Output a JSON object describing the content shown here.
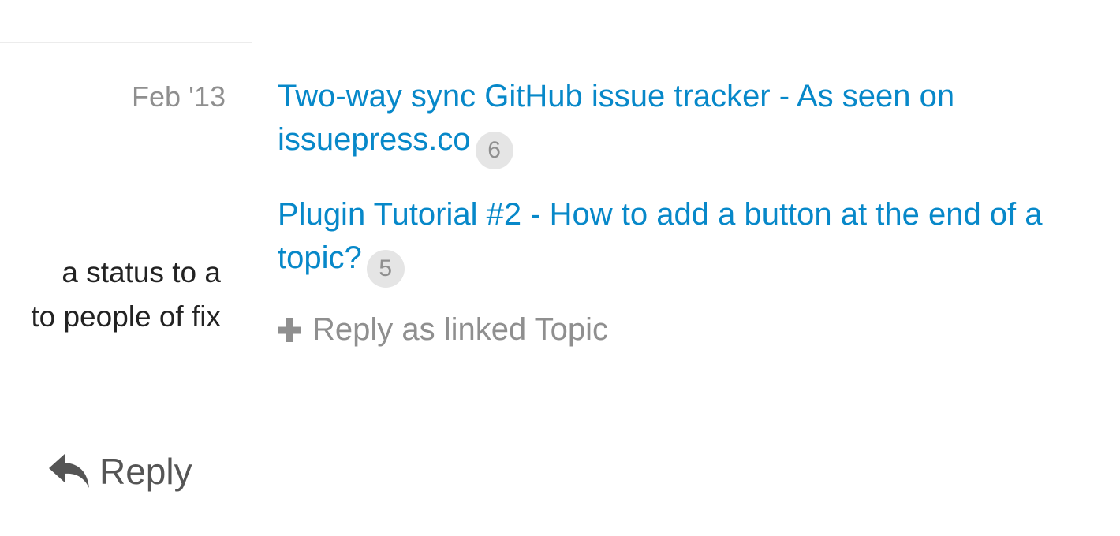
{
  "post": {
    "date": "Feb '13",
    "body_lines": [
      "a status to a",
      "to people of fix"
    ],
    "reply_label": "Reply"
  },
  "linked_topics": [
    {
      "title": "Two-way sync GitHub issue tracker - As seen on issuepress.co",
      "count": "6"
    },
    {
      "title": "Plugin Tutorial #2 - How to add a button at the end of a topic?",
      "count": "5"
    }
  ],
  "reply_as_linked_topic_label": "Reply as linked Topic",
  "icons": {
    "reply": "reply-arrow-icon",
    "plus": "plus-icon"
  },
  "colors": {
    "link": "#0788c9",
    "muted": "#8f8f8f",
    "badge_bg": "#e5e5e5",
    "text": "#222222"
  }
}
